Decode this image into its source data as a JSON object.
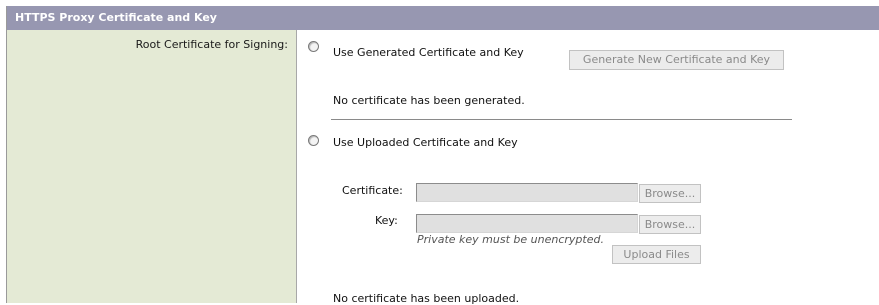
{
  "section": {
    "title": "HTTPS Proxy Certificate and Key",
    "row_label": "Root Certificate for Signing:"
  },
  "generated": {
    "option_label": "Use Generated Certificate and Key",
    "generate_button": "Generate New Certificate and Key",
    "status": "No certificate has been generated."
  },
  "uploaded": {
    "option_label": "Use Uploaded Certificate and Key",
    "certificate_label": "Certificate:",
    "key_label": "Key:",
    "browse_button": "Browse...",
    "key_hint": "Private key must be unencrypted.",
    "upload_button": "Upload Files",
    "status": "No certificate has been uploaded.",
    "certificate_value": "",
    "key_value": ""
  }
}
